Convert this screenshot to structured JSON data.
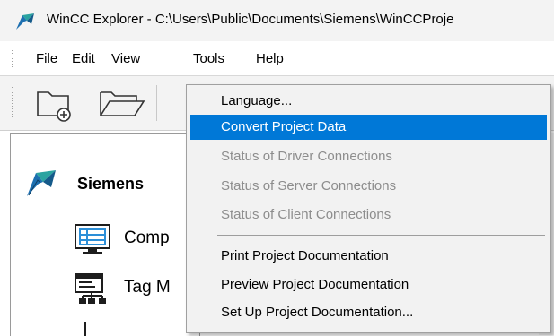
{
  "window": {
    "title": "WinCC Explorer - C:\\Users\\Public\\Documents\\Siemens\\WinCCProje",
    "app_icon": "wincc-shark-icon"
  },
  "menubar": {
    "items": [
      {
        "label": "File"
      },
      {
        "label": "Edit"
      },
      {
        "label": "View"
      },
      {
        "label": "Tools"
      },
      {
        "label": "Help"
      }
    ]
  },
  "toolbar": {
    "buttons": [
      {
        "icon": "new-project-folder-icon"
      },
      {
        "icon": "open-folder-icon"
      }
    ]
  },
  "tree": {
    "root": {
      "label": "Siemens",
      "icon": "wincc-shark-icon"
    },
    "nodes": [
      {
        "label": "Comp",
        "icon": "computer-list-icon"
      },
      {
        "label": "Tag M",
        "icon": "tag-management-icon"
      }
    ]
  },
  "tools_menu": {
    "items": [
      {
        "label": "Language...",
        "state": "enabled"
      },
      {
        "label": "Convert Project Data",
        "state": "selected"
      },
      {
        "label": "Status of Driver Connections",
        "state": "disabled"
      },
      {
        "label": "Status of Server Connections",
        "state": "disabled"
      },
      {
        "label": "Status of Client Connections",
        "state": "disabled"
      },
      {
        "label": "Print Project Documentation",
        "state": "enabled"
      },
      {
        "label": "Preview Project Documentation",
        "state": "enabled"
      },
      {
        "label": "Set Up Project Documentation...",
        "state": "enabled"
      }
    ]
  },
  "colors": {
    "selection": "#0078d7",
    "disabled_text": "#8d8d8d",
    "menu_bg": "#f2f2f2",
    "shark_blue": "#1c6fb0",
    "shark_teal": "#2aa3a0"
  }
}
